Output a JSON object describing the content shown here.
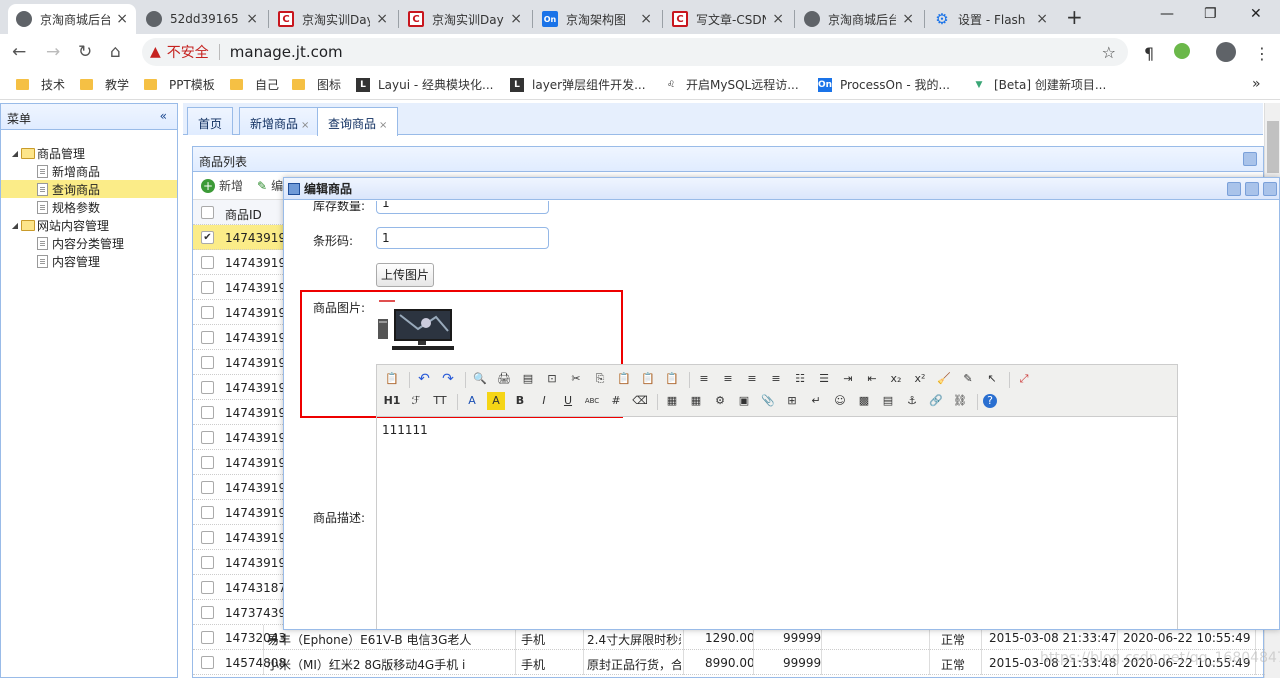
{
  "browser": {
    "tabs": [
      {
        "title": "京淘商城后台",
        "icon": "globe-icon",
        "active": true
      },
      {
        "title": "52dd39165",
        "icon": "globe-icon"
      },
      {
        "title": "京淘实训Day",
        "icon": "csdn-icon"
      },
      {
        "title": "京淘实训Day",
        "icon": "csdn-icon"
      },
      {
        "title": "京淘架构图",
        "icon": "processon-icon"
      },
      {
        "title": "写文章-CSDN",
        "icon": "csdn-icon"
      },
      {
        "title": "京淘商城后台",
        "icon": "globe-icon"
      },
      {
        "title": "设置 - Flash",
        "icon": "gear-icon"
      }
    ],
    "security_label": "不安全",
    "url": "manage.jt.com",
    "bookmarks": [
      {
        "label": "技术",
        "type": "folder"
      },
      {
        "label": "教学",
        "type": "folder"
      },
      {
        "label": "PPT模板",
        "type": "folder"
      },
      {
        "label": "自己",
        "type": "folder"
      },
      {
        "label": "图标",
        "type": "folder"
      },
      {
        "label": "Layui - 经典模块化...",
        "type": "site"
      },
      {
        "label": "layer弹层组件开发...",
        "type": "site"
      },
      {
        "label": "开启MySQL远程访...",
        "type": "site"
      },
      {
        "label": "ProcessOn - 我的...",
        "type": "site"
      },
      {
        "label": "[Beta] 创建新项目...",
        "type": "site"
      }
    ]
  },
  "sidebar": {
    "title": "菜单",
    "tree": [
      {
        "label": "商品管理",
        "type": "folder",
        "level": 0
      },
      {
        "label": "新增商品",
        "type": "file",
        "level": 1
      },
      {
        "label": "查询商品",
        "type": "file",
        "level": 1,
        "selected": true
      },
      {
        "label": "规格参数",
        "type": "file",
        "level": 1
      },
      {
        "label": "网站内容管理",
        "type": "folder",
        "level": 0
      },
      {
        "label": "内容分类管理",
        "type": "file",
        "level": 1
      },
      {
        "label": "内容管理",
        "type": "file",
        "level": 1
      }
    ]
  },
  "content_tabs": [
    {
      "label": "首页",
      "closable": false
    },
    {
      "label": "新增商品",
      "closable": true
    },
    {
      "label": "查询商品",
      "closable": true,
      "active": true
    }
  ],
  "grid": {
    "title": "商品列表",
    "toolbar": {
      "add": "新增",
      "edit": "编"
    },
    "header_id": "商品ID",
    "rows": [
      {
        "id": "14743919",
        "checked": true
      },
      {
        "id": "14743919"
      },
      {
        "id": "14743919"
      },
      {
        "id": "14743919"
      },
      {
        "id": "14743919"
      },
      {
        "id": "14743919"
      },
      {
        "id": "14743919"
      },
      {
        "id": "14743919"
      },
      {
        "id": "14743919"
      },
      {
        "id": "14743919"
      },
      {
        "id": "14743919"
      },
      {
        "id": "14743919"
      },
      {
        "id": "14743919"
      },
      {
        "id": "14743919"
      },
      {
        "id": "14743187"
      },
      {
        "id": "14737439"
      },
      {
        "id": "14732043",
        "title": "易丰（Ephone）E61V-B 电信3G老人",
        "cat": "手机",
        "point": "2.4寸大屏限时秒杀",
        "price": "1290.00",
        "num": "99999",
        "status": "正常",
        "created": "2015-03-08 21:33:47",
        "updated": "2020-06-22 10:55:49"
      },
      {
        "id": "14574808",
        "title": "小米（MI）红米2 8G版移动4G手机 i",
        "cat": "手机",
        "point": "原封正品行货，合",
        "price": "8990.00",
        "num": "99999",
        "status": "正常",
        "created": "2015-03-08 21:33:48",
        "updated": "2020-06-22 10:55:49"
      }
    ]
  },
  "dialog": {
    "title": "编辑商品",
    "fields": {
      "stock_label": "库存数量:",
      "stock_value": "1",
      "barcode_label": "条形码:",
      "barcode_value": "1",
      "upload_button": "上传图片",
      "image_label": "商品图片:",
      "desc_label": "商品描述:",
      "editor_content": "111111"
    }
  },
  "watermark": "https://blog.csdn.net/qq_16804847"
}
